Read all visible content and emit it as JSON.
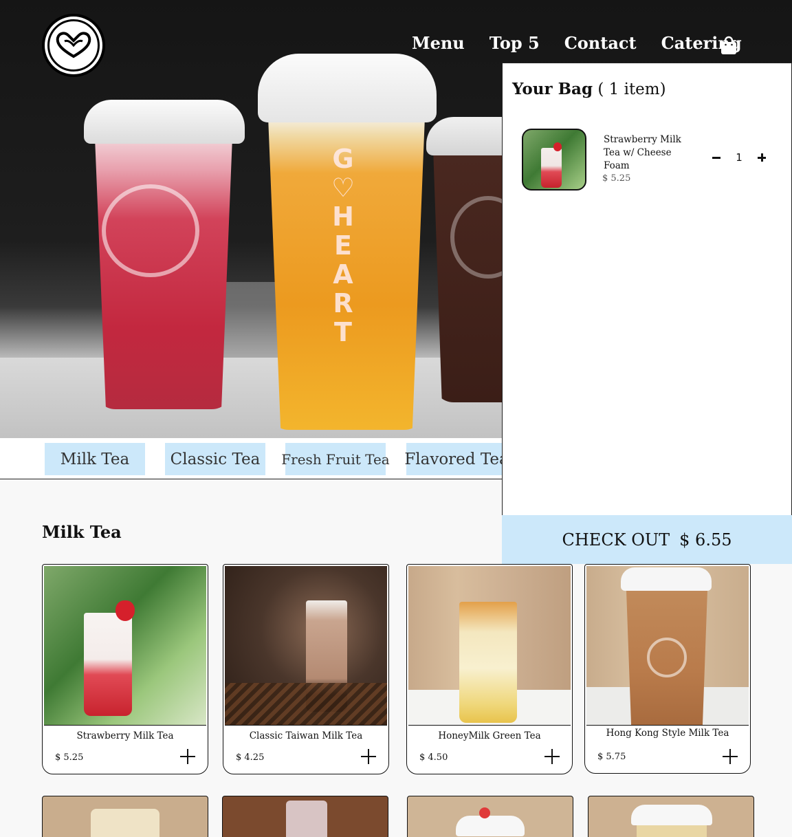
{
  "nav": {
    "items": [
      "Menu",
      "Top 5",
      "Contact",
      "Catering"
    ]
  },
  "hero": {
    "cup_text": "GO HEART"
  },
  "categories": [
    "Milk Tea",
    "Classic Tea",
    "Fresh Fruit Tea",
    "Flavored Tea"
  ],
  "section": {
    "title": "Milk Tea",
    "products": [
      {
        "name": "Strawberry Milk Tea",
        "price": "$ 5.25"
      },
      {
        "name": "Classic Taiwan Milk Tea",
        "price": "$ 4.25"
      },
      {
        "name": "HoneyMilk Green Tea",
        "price": "$ 4.50"
      },
      {
        "name": "Hong Kong Style Milk Tea",
        "price": "$ 5.75"
      }
    ]
  },
  "bag": {
    "title": "Your Bag",
    "count_text": "( 1 item)",
    "items": [
      {
        "name": "Strawberry Milk Tea w/ Cheese Foam",
        "price": "$ 5.25",
        "qty": "1"
      }
    ],
    "checkout_label": "CHECK OUT",
    "total": "$ 6.55"
  },
  "colors": {
    "accent": "#cce8fa",
    "text": "#111111"
  }
}
